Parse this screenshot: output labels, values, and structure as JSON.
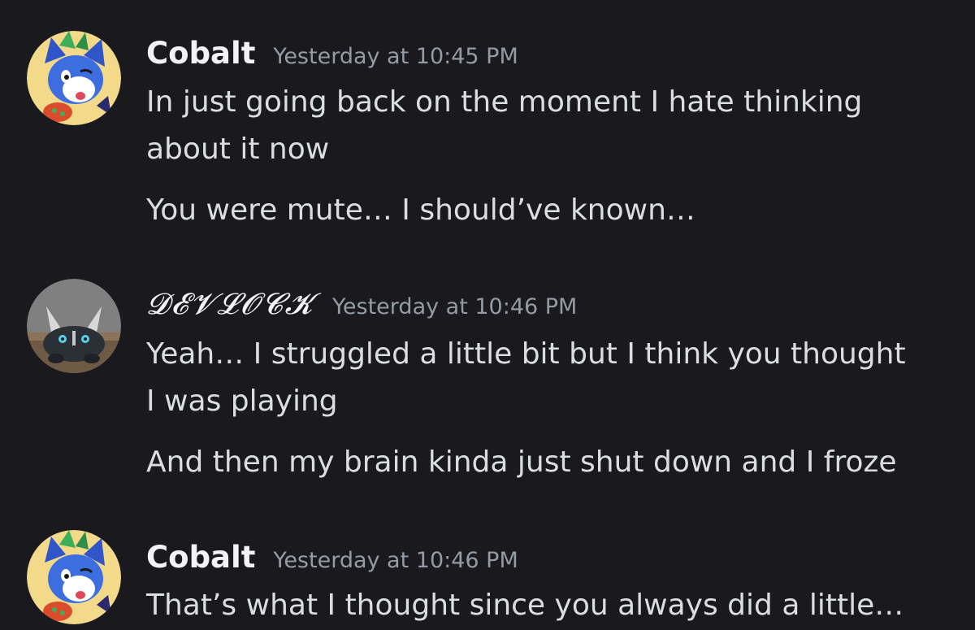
{
  "messages": [
    {
      "username": "Cobalt",
      "timestamp": "Yesterday at 10:45 PM",
      "lines": [
        "In just going back on the moment I hate thinking",
        "about it now",
        "You were mute… I should’ve known…"
      ]
    },
    {
      "username": "𝓓𝓔𝓥𝓛𝓞𝓒𝓚",
      "timestamp": "Yesterday at 10:46 PM",
      "lines": [
        "Yeah… I struggled a little bit but I think you thought",
        "I was playing",
        "And then my brain kinda just shut down and I froze"
      ]
    },
    {
      "username": "Cobalt",
      "timestamp": "Yesterday at 10:46 PM",
      "lines": [
        "That’s what I thought since you always did a little…"
      ]
    }
  ],
  "colors": {
    "background": "#1a1a1e",
    "username": "#f2f3f5",
    "timestamp": "#949ba4",
    "message_text": "#dbdee1"
  }
}
